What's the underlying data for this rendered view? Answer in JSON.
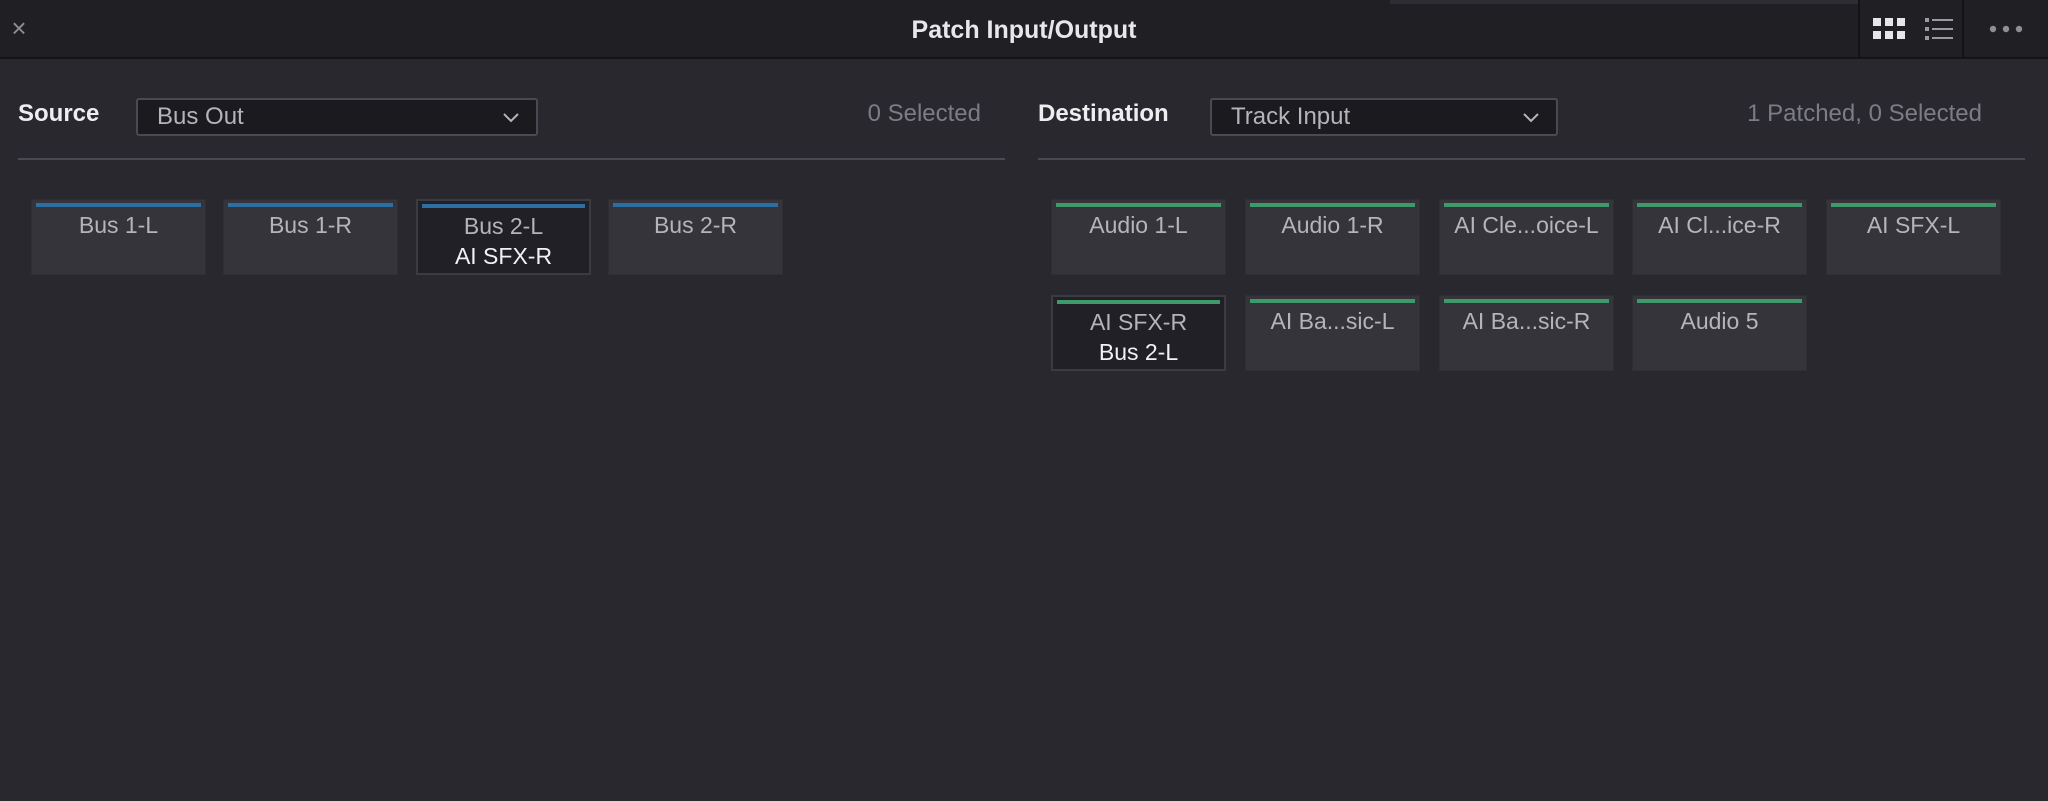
{
  "window": {
    "title": "Patch Input/Output",
    "close_glyph": "×"
  },
  "view_controls": {
    "grid_icon": "grid-view-icon",
    "list_icon": "list-view-icon",
    "more_icon": "more-options-icon"
  },
  "source": {
    "label": "Source",
    "dropdown_value": "Bus Out",
    "status": "0 Selected",
    "tiles": [
      {
        "name": "Bus 1-L",
        "patch": ""
      },
      {
        "name": "Bus 1-R",
        "patch": ""
      },
      {
        "name": "Bus 2-L",
        "patch": "AI SFX-R"
      },
      {
        "name": "Bus 2-R",
        "patch": ""
      }
    ]
  },
  "destination": {
    "label": "Destination",
    "dropdown_value": "Track Input",
    "status": "1 Patched, 0 Selected",
    "tiles": [
      {
        "name": "Audio 1-L",
        "patch": ""
      },
      {
        "name": "Audio 1-R",
        "patch": ""
      },
      {
        "name": "AI Cle...oice-L",
        "patch": ""
      },
      {
        "name": "AI Cl...ice-R",
        "patch": ""
      },
      {
        "name": "AI SFX-L",
        "patch": ""
      },
      {
        "name": "AI SFX-R",
        "patch": "Bus 2-L"
      },
      {
        "name": "AI Ba...sic-L",
        "patch": ""
      },
      {
        "name": "AI Ba...sic-R",
        "patch": ""
      },
      {
        "name": "Audio 5",
        "patch": ""
      }
    ]
  },
  "colors": {
    "source_accent": "#2b6fa3",
    "destination_accent": "#3e9a6a",
    "background": "#28282e"
  }
}
